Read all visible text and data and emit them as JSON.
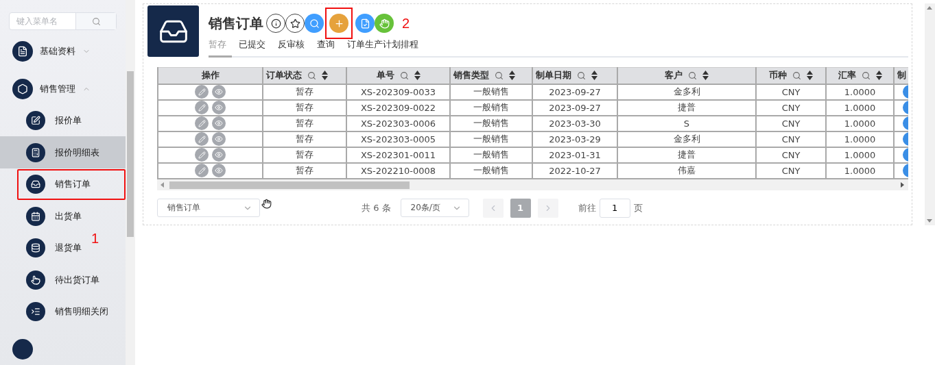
{
  "sidebar": {
    "search": {
      "placeholder": "键入菜单名"
    },
    "groups": [
      {
        "label": "基础资料",
        "expanded": false
      },
      {
        "label": "销售管理",
        "expanded": true,
        "children": [
          {
            "label": "报价单",
            "selected": false,
            "highlighted": false
          },
          {
            "label": "报价明细表",
            "selected": true,
            "highlighted": false
          },
          {
            "label": "销售订单",
            "selected": false,
            "highlighted": true
          },
          {
            "label": "出货单",
            "selected": false,
            "highlighted": false
          },
          {
            "label": "退货单",
            "selected": false,
            "highlighted": false
          },
          {
            "label": "待出货订单",
            "selected": false,
            "highlighted": false
          },
          {
            "label": "销售明细关闭",
            "selected": false,
            "highlighted": false
          }
        ]
      }
    ]
  },
  "annotations": [
    {
      "text": "1"
    },
    {
      "text": "2"
    }
  ],
  "page": {
    "title": "销售订单",
    "actions": [
      {
        "kind": "info",
        "highlighted": false
      },
      {
        "kind": "star",
        "highlighted": false
      },
      {
        "kind": "search",
        "highlighted": false
      },
      {
        "kind": "add",
        "highlighted": true
      },
      {
        "kind": "doc",
        "highlighted": false
      },
      {
        "kind": "hand",
        "highlighted": false
      }
    ],
    "tabs": [
      {
        "label": "暂存",
        "selected": true
      },
      {
        "label": "已提交",
        "selected": false
      },
      {
        "label": "反审核",
        "selected": false
      },
      {
        "label": "查询",
        "selected": false
      },
      {
        "label": "订单生产计划排程",
        "selected": false
      }
    ]
  },
  "table": {
    "action_column": "操作",
    "columns": [
      "订单状态",
      "单号",
      "销售类型",
      "制单日期",
      "客户",
      "币种",
      "汇率"
    ],
    "cut_column": "制",
    "rows": [
      [
        "暂存",
        "XS-202309-0033",
        "一般销售",
        "2023-09-27",
        "金多利",
        "CNY",
        "1.0000"
      ],
      [
        "暂存",
        "XS-202309-0022",
        "一般销售",
        "2023-09-27",
        "捷普",
        "CNY",
        "1.0000"
      ],
      [
        "暂存",
        "XS-202303-0006",
        "一般销售",
        "2023-03-30",
        "S",
        "CNY",
        "1.0000"
      ],
      [
        "暂存",
        "XS-202303-0005",
        "一般销售",
        "2023-03-29",
        "金多利",
        "CNY",
        "1.0000"
      ],
      [
        "暂存",
        "XS-202301-0011",
        "一般销售",
        "2023-01-31",
        "捷普",
        "CNY",
        "1.0000"
      ],
      [
        "暂存",
        "XS-202210-0008",
        "一般销售",
        "2022-10-27",
        "伟嘉",
        "CNY",
        "1.0000"
      ]
    ]
  },
  "footer": {
    "view_select": "销售订单",
    "total": "共 6 条",
    "page_size": "20条/页",
    "current_page": "1",
    "goto_label": "前往",
    "goto_value": "1",
    "page_unit": "页"
  }
}
